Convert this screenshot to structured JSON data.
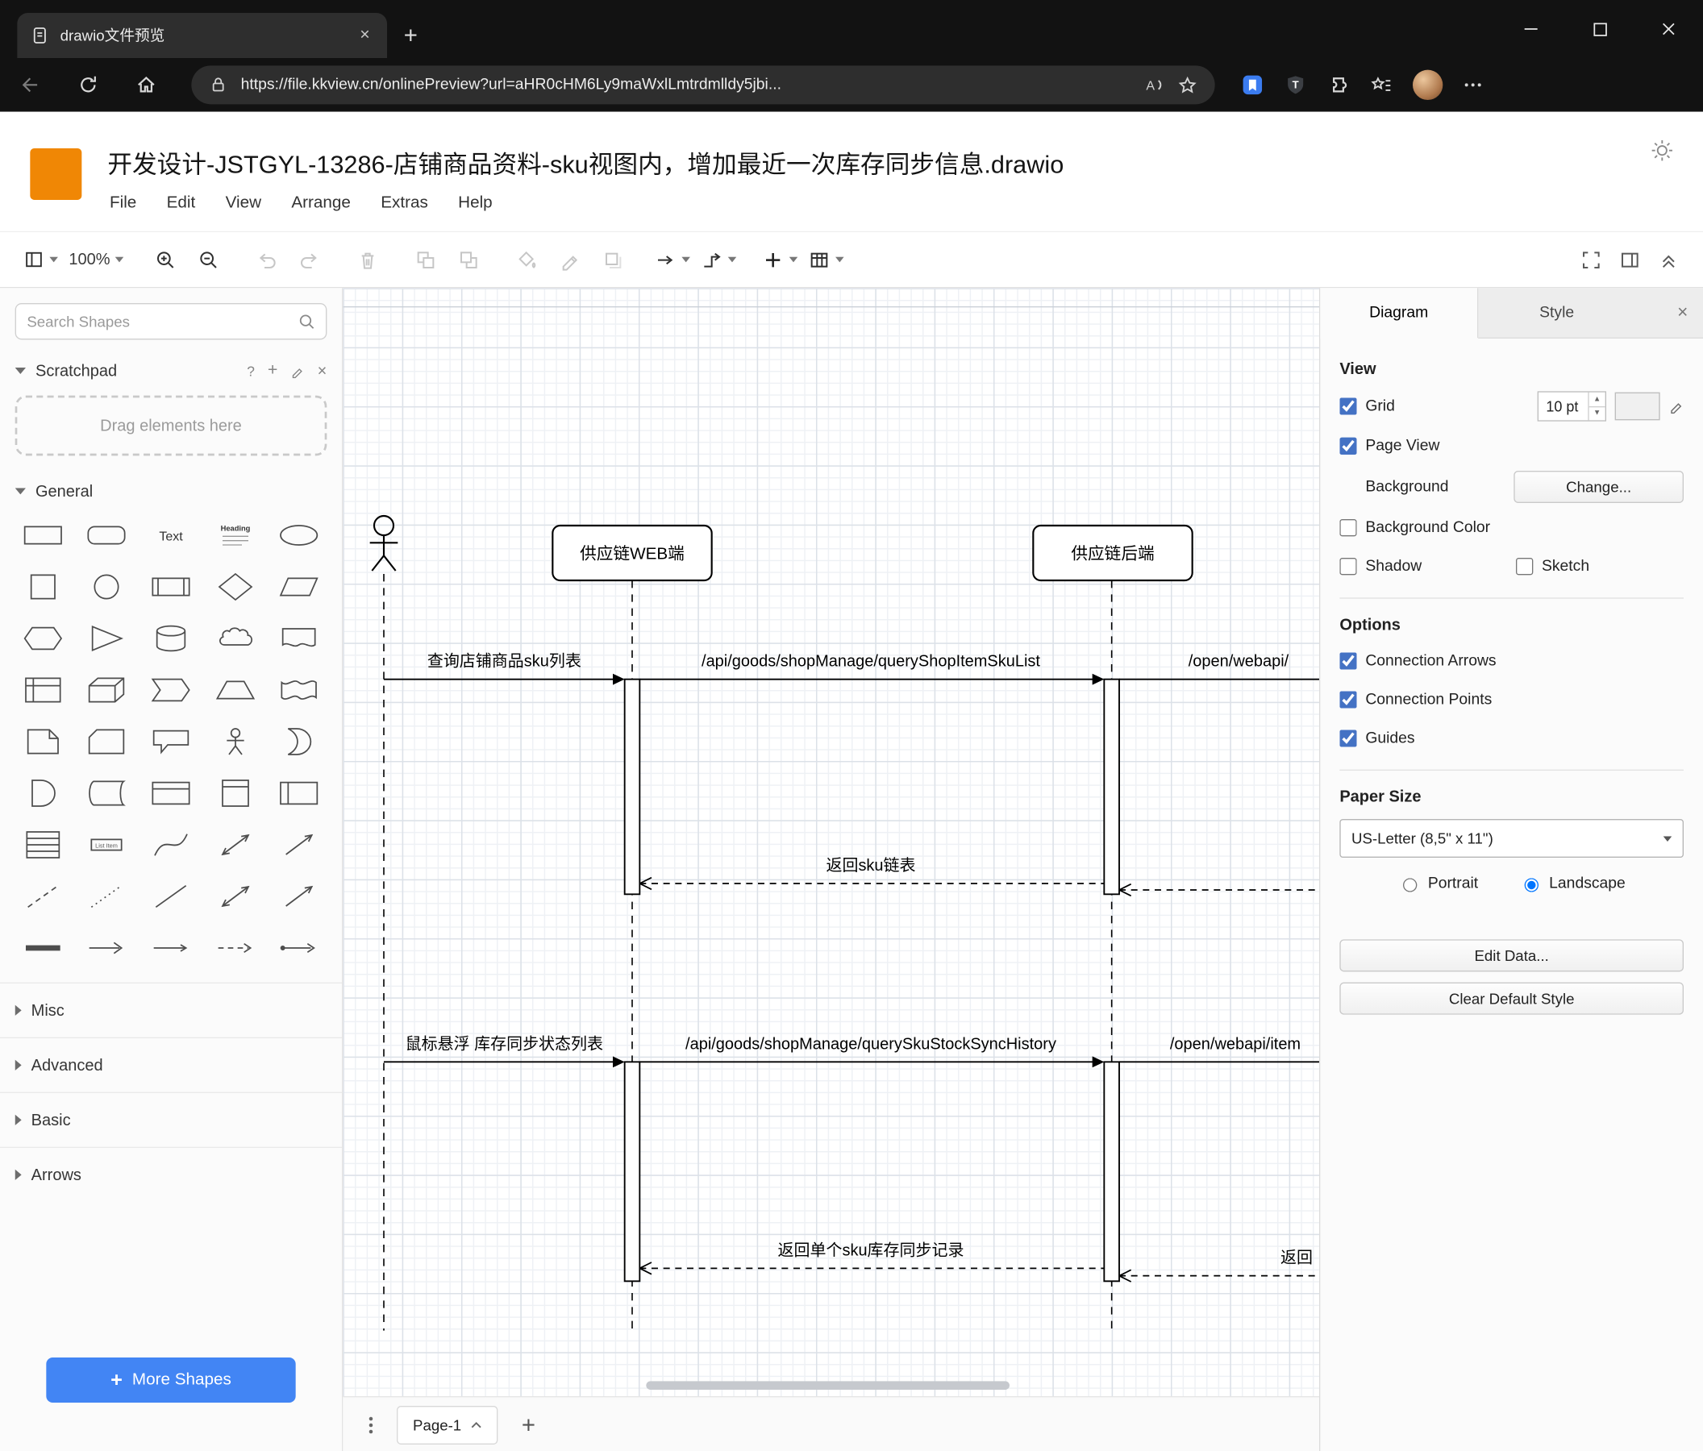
{
  "browser": {
    "tab_title": "drawio文件预览",
    "url": "https://file.kkview.cn/onlinePreview?url=aHR0cHM6Ly9maWxlLmtrdmlldy5jbi..."
  },
  "app": {
    "title": "开发设计-JSTGYL-13286-店铺商品资料-sku视图内，增加最近一次库存同步信息.drawio",
    "menus": [
      "File",
      "Edit",
      "View",
      "Arrange",
      "Extras",
      "Help"
    ],
    "toolbar": {
      "zoom": "100%"
    },
    "sidebar": {
      "search_placeholder": "Search Shapes",
      "scratchpad_label": "Scratchpad",
      "drop_hint": "Drag elements here",
      "section_general": "General",
      "section_misc": "Misc",
      "section_advanced": "Advanced",
      "section_basic": "Basic",
      "section_arrows": "Arrows",
      "more_shapes": "More Shapes",
      "shapes": [
        "rectangle",
        "rounded-rectangle",
        "text",
        "textbox",
        "ellipse",
        "square",
        "circle",
        "process",
        "diamond",
        "parallelogram",
        "hexagon",
        "triangle",
        "cylinder",
        "cloud",
        "document",
        "internal-storage",
        "cube",
        "step",
        "trapezoid",
        "tape",
        "note",
        "card",
        "callout",
        "actor",
        "or",
        "and",
        "data-storage",
        "container",
        "vertical-container",
        "horizontal-container",
        "list",
        "list-item",
        "curve",
        "bidirectional-arrow",
        "arrow",
        "dashed-line",
        "dotted-line",
        "line",
        "bidirectional-connector",
        "directional-connector",
        "link",
        "arrow-right",
        "thin-arrow",
        "dashed-arrow",
        "connector"
      ]
    },
    "footer": {
      "page_tab": "Page-1"
    },
    "format_panel": {
      "tab_diagram": "Diagram",
      "tab_style": "Style",
      "view_heading": "View",
      "grid_label": "Grid",
      "grid_size": "10 pt",
      "grid_checked": true,
      "page_view_label": "Page View",
      "page_view_checked": true,
      "background_label": "Background",
      "change_button": "Change...",
      "background_color_label": "Background Color",
      "background_color_checked": false,
      "shadow_label": "Shadow",
      "shadow_checked": false,
      "sketch_label": "Sketch",
      "sketch_checked": false,
      "options_heading": "Options",
      "connection_arrows_label": "Connection Arrows",
      "connection_arrows_checked": true,
      "connection_points_label": "Connection Points",
      "connection_points_checked": true,
      "guides_label": "Guides",
      "guides_checked": true,
      "paper_heading": "Paper Size",
      "paper_size": "US-Letter (8,5\" x 11\")",
      "portrait_label": "Portrait",
      "portrait_checked": false,
      "landscape_label": "Landscape",
      "landscape_checked": true,
      "edit_data_button": "Edit Data...",
      "clear_style_button": "Clear Default Style"
    }
  },
  "diagram": {
    "participants": {
      "web": "供应链WEB端",
      "backend": "供应链后端"
    },
    "messages": {
      "m1": "查询店铺商品sku列表",
      "m2": "/api/goods/shopManage/queryShopItemSkuList",
      "m3": "/open/webapi/",
      "r1": "返回sku链表",
      "m4": "鼠标悬浮 库存同步状态列表",
      "m5": "/api/goods/shopManage/querySkuStockSyncHistory",
      "m6": "/open/webapi/item",
      "r2": "返回单个sku库存同步记录",
      "r3": "返回"
    }
  }
}
